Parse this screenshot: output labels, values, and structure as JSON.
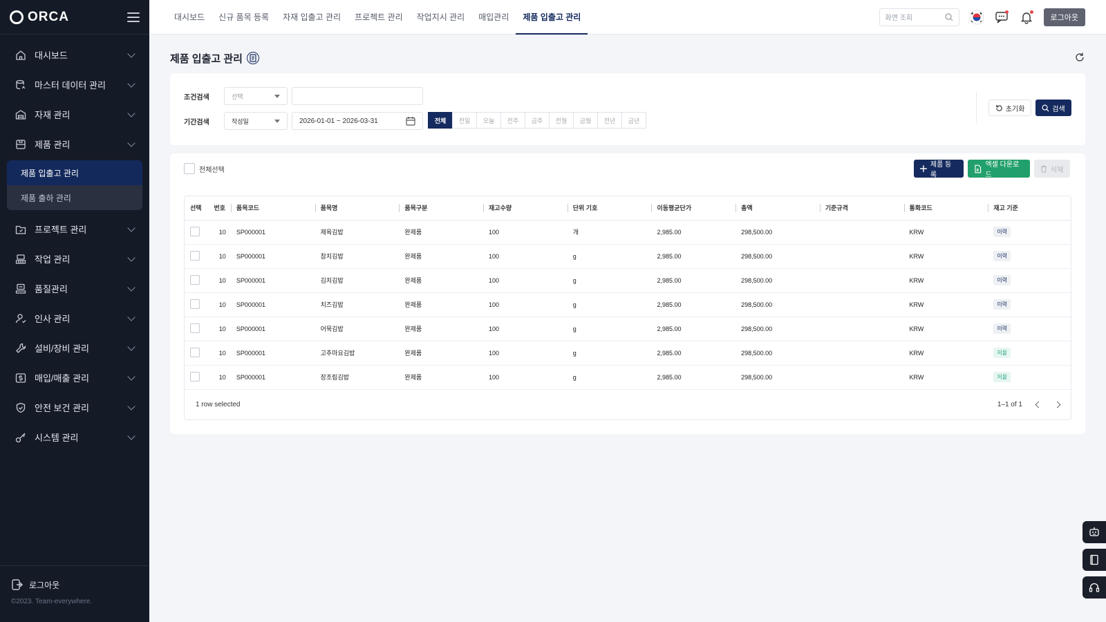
{
  "app": {
    "logo": "ORCA"
  },
  "sidebar": {
    "items": [
      {
        "label": "대시보드",
        "icon": "home-icon"
      },
      {
        "label": "마스터 데이터 관리",
        "icon": "database-icon"
      },
      {
        "label": "자재 관리",
        "icon": "warehouse-icon"
      },
      {
        "label": "제품 관리",
        "icon": "box-icon"
      },
      {
        "label": "프로젝트 관리",
        "icon": "folder-icon"
      },
      {
        "label": "작업 관리",
        "icon": "factory-icon"
      },
      {
        "label": "품질관리",
        "icon": "quality-icon"
      },
      {
        "label": "인사 관리",
        "icon": "user-icon"
      },
      {
        "label": "설비/장비 관리",
        "icon": "wrench-icon"
      },
      {
        "label": "매입/매출 관리",
        "icon": "dollar-icon"
      },
      {
        "label": "안전 보건 관리",
        "icon": "shield-icon"
      },
      {
        "label": "시스템 관리",
        "icon": "key-icon"
      }
    ],
    "submenu": [
      {
        "label": "제품 입출고 관리",
        "active": true
      },
      {
        "label": "제품 출하 관리",
        "active": false
      }
    ],
    "logout": "로그아웃",
    "copyright": "©2023. Team-everywhere."
  },
  "topbar": {
    "tabs": [
      {
        "label": "대시보드",
        "active": false
      },
      {
        "label": "신규 품목 등록",
        "active": false
      },
      {
        "label": "자재 입출고 관리",
        "active": false
      },
      {
        "label": "프로젝트 관리",
        "active": false
      },
      {
        "label": "작업지시 관리",
        "active": false
      },
      {
        "label": "매입관리",
        "active": false
      },
      {
        "label": "제품 입출고 관리",
        "active": true
      }
    ],
    "search_placeholder": "화면 조회",
    "logout_label": "로그아웃"
  },
  "page": {
    "title": "제품 입출고 관리"
  },
  "filter": {
    "condition_label": "조건검색",
    "condition_select": "선택",
    "condition_value": "",
    "period_label": "기간검색",
    "period_select": "작성일",
    "date_range": "2026-01-01 ~ 2026-03-31",
    "period_buttons": [
      "전체",
      "전일",
      "오늘",
      "전주",
      "금주",
      "전월",
      "금월",
      "전년",
      "금년"
    ],
    "active_period": "전체",
    "reset_label": "초기화",
    "search_label": "검색"
  },
  "toolbar": {
    "select_all": "전체선택",
    "add_label": "제품 등록",
    "excel_label": "엑셀 다운로드",
    "delete_label": "삭제"
  },
  "table": {
    "columns": [
      "선택",
      "번호",
      "품목코드",
      "품목명",
      "품목구분",
      "재고수량",
      "단위 기호",
      "이동평균단가",
      "총액",
      "기준규격",
      "통화코드",
      "재고 기준"
    ],
    "rows": [
      {
        "no": "10",
        "code": "SP000001",
        "name": "제육김밥",
        "type": "완제품",
        "qty": "100",
        "unit": "개",
        "avg_price": "2,985.00",
        "total": "298,500.00",
        "spec": "",
        "currency": "KRW",
        "basis": "이력",
        "basis_kind": "history"
      },
      {
        "no": "10",
        "code": "SP000001",
        "name": "참치김밥",
        "type": "완제품",
        "qty": "100",
        "unit": "g",
        "avg_price": "2,985.00",
        "total": "298,500.00",
        "spec": "",
        "currency": "KRW",
        "basis": "이력",
        "basis_kind": "history"
      },
      {
        "no": "10",
        "code": "SP000001",
        "name": "김치김밥",
        "type": "완제품",
        "qty": "100",
        "unit": "g",
        "avg_price": "2,985.00",
        "total": "298,500.00",
        "spec": "",
        "currency": "KRW",
        "basis": "이력",
        "basis_kind": "history"
      },
      {
        "no": "10",
        "code": "SP000001",
        "name": "치즈김밥",
        "type": "완제품",
        "qty": "100",
        "unit": "g",
        "avg_price": "2,985.00",
        "total": "298,500.00",
        "spec": "",
        "currency": "KRW",
        "basis": "이력",
        "basis_kind": "history"
      },
      {
        "no": "10",
        "code": "SP000001",
        "name": "어묵김밥",
        "type": "완제품",
        "qty": "100",
        "unit": "g",
        "avg_price": "2,985.00",
        "total": "298,500.00",
        "spec": "",
        "currency": "KRW",
        "basis": "이력",
        "basis_kind": "history"
      },
      {
        "no": "10",
        "code": "SP000001",
        "name": "고추마요김밥",
        "type": "완제품",
        "qty": "100",
        "unit": "g",
        "avg_price": "2,985.00",
        "total": "298,500.00",
        "spec": "",
        "currency": "KRW",
        "basis": "저울",
        "basis_kind": "stock"
      },
      {
        "no": "10",
        "code": "SP000001",
        "name": "장조림김밥",
        "type": "완제품",
        "qty": "100",
        "unit": "g",
        "avg_price": "2,985.00",
        "total": "298,500.00",
        "spec": "",
        "currency": "KRW",
        "basis": "저울",
        "basis_kind": "stock"
      }
    ],
    "selected_text": "1 row selected",
    "pagination": "1–1 of 1"
  },
  "floating": [
    "robot-icon",
    "book-icon",
    "headset-icon"
  ],
  "colors": {
    "navy": "#152a5e",
    "sidebar_bg": "#151a27",
    "excel_green": "#22a06b"
  }
}
